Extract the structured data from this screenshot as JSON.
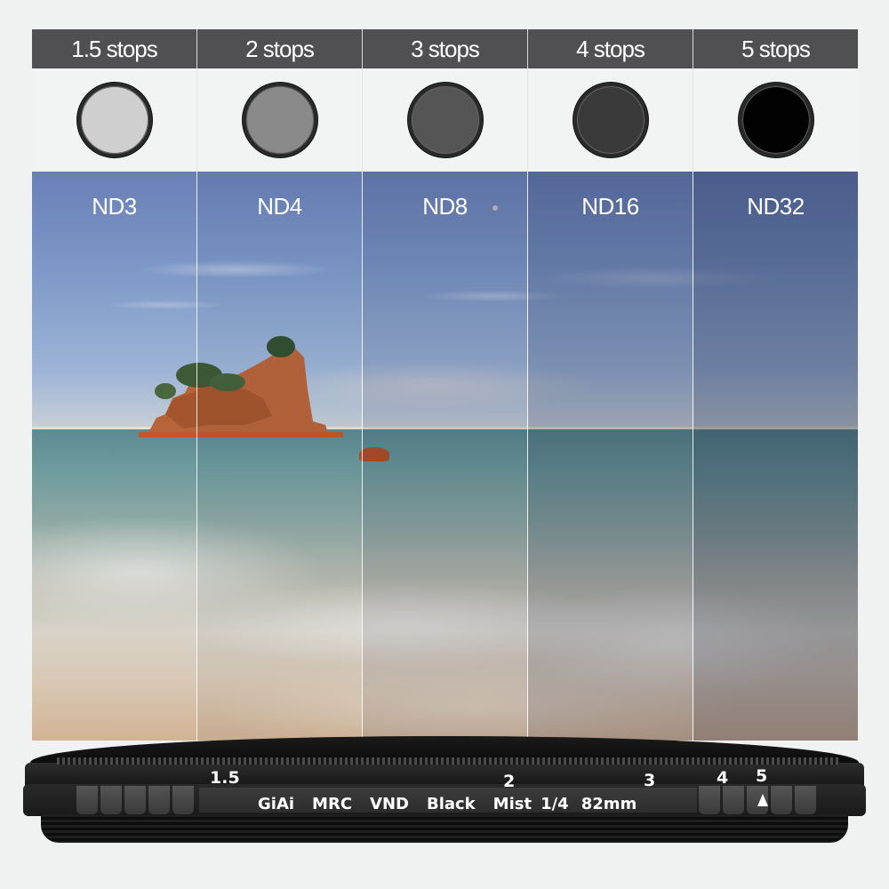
{
  "columns": [
    {
      "stops": "1.5 stops",
      "nd": "ND3",
      "filter_color": "#cfcfcf"
    },
    {
      "stops": "2 stops",
      "nd": "ND4",
      "filter_color": "#8a8a8a"
    },
    {
      "stops": "3 stops",
      "nd": "ND8",
      "filter_color": "#555555"
    },
    {
      "stops": "4 stops",
      "nd": "ND16",
      "filter_color": "#3a3a3a"
    },
    {
      "stops": "5 stops",
      "nd": "ND32",
      "filter_color": "#020202"
    }
  ],
  "lens": {
    "scale": [
      "1.5",
      "2",
      "3",
      "4",
      "5"
    ],
    "engraving": [
      "GiAi",
      "MRC",
      "VND",
      "Black",
      "Mist",
      "1/4",
      "82mm"
    ]
  },
  "colors": {
    "header_bg": "#505052",
    "page_bg": "#f0f1f1"
  }
}
